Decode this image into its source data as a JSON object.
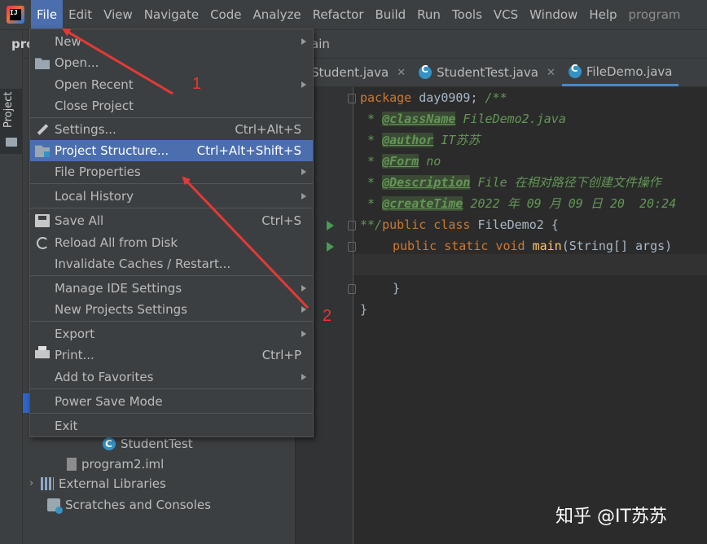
{
  "menubar": {
    "items": [
      "File",
      "Edit",
      "View",
      "Navigate",
      "Code",
      "Analyze",
      "Refactor",
      "Build",
      "Run",
      "Tools",
      "VCS",
      "Window",
      "Help",
      "program"
    ],
    "active_index": 0
  },
  "project_panel": {
    "tab_label": "Project",
    "header_title": "pro",
    "tree": [
      {
        "label": "StudentTest",
        "icon": "class-icon"
      },
      {
        "label": "program2.iml",
        "icon": "module-file-icon"
      },
      {
        "label": "External Libraries",
        "icon": "library-icon"
      },
      {
        "label": "Scratches and Consoles",
        "icon": "scratches-icon"
      }
    ]
  },
  "editor": {
    "breadcrumb": "ain",
    "tabs": [
      {
        "label": "Student.java"
      },
      {
        "label": "StudentTest.java"
      },
      {
        "label": "FileDemo.java"
      }
    ],
    "code": {
      "line1": {
        "kw": "package",
        "rest": " day0909; ",
        "doc": "/**"
      },
      "line2": {
        "prefix": " * ",
        "tag": "@className",
        "rest": " FileDemo2.java"
      },
      "line3": {
        "prefix": " * ",
        "tag": "@author",
        "rest": " IT苏苏"
      },
      "line4": {
        "prefix": " * ",
        "tag": "@Form",
        "rest": " no"
      },
      "line5": {
        "prefix": " * ",
        "tag": "@Description",
        "rest": " File 在相对路径下创建文件操作"
      },
      "line6": {
        "prefix": " * ",
        "tag": "@createTime",
        "rest": " 2022 年 09 月 09 日 20  20:24"
      },
      "line7": {
        "doc": "**/",
        "kw": "public class",
        "rest": " FileDemo2 {"
      },
      "line8": {
        "kw": "public static void",
        "fn": "main",
        "rest": "(String[] args)"
      },
      "line10": {
        "text": "}"
      },
      "line11": {
        "text": "}"
      }
    }
  },
  "file_menu": {
    "items": [
      {
        "label": "New",
        "submenu": true
      },
      {
        "label": "Open...",
        "icon": "folder-open-icon"
      },
      {
        "label": "Open Recent",
        "submenu": true
      },
      {
        "label": "Close Project"
      },
      {
        "label": "Settings...",
        "shortcut": "Ctrl+Alt+S",
        "icon": "wrench-icon"
      },
      {
        "label": "Project Structure...",
        "shortcut": "Ctrl+Alt+Shift+S",
        "icon": "project-structure-icon",
        "selected": true
      },
      {
        "label": "File Properties",
        "submenu": true
      },
      {
        "label": "Local History",
        "submenu": true
      },
      {
        "label": "Save All",
        "shortcut": "Ctrl+S",
        "icon": "save-icon"
      },
      {
        "label": "Reload All from Disk",
        "icon": "reload-icon"
      },
      {
        "label": "Invalidate Caches / Restart..."
      },
      {
        "label": "Manage IDE Settings",
        "submenu": true
      },
      {
        "label": "New Projects Settings",
        "submenu": true
      },
      {
        "label": "Export",
        "submenu": true
      },
      {
        "label": "Print...",
        "shortcut": "Ctrl+P",
        "icon": "print-icon"
      },
      {
        "label": "Add to Favorites",
        "submenu": true
      },
      {
        "label": "Power Save Mode"
      },
      {
        "label": "Exit"
      }
    ]
  },
  "annotations": {
    "step1": "1",
    "step2": "2",
    "arrow_color": "#e53935"
  },
  "watermark": "知乎 @IT苏苏",
  "colors": {
    "menubar_bg": "#3c3f41",
    "selection": "#4b6eaf",
    "editor_bg": "#2b2b2b",
    "keyword": "#cc7832",
    "doc_comment": "#629755"
  }
}
